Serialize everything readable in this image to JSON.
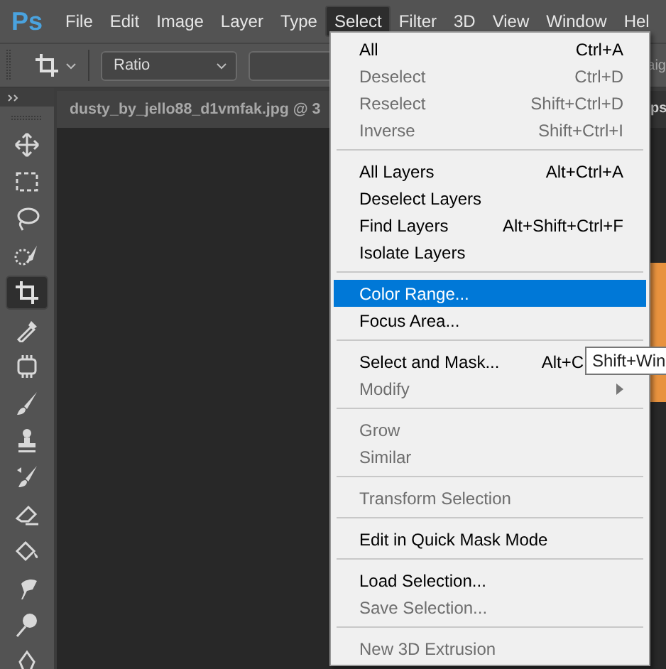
{
  "app_logo": "Ps",
  "menubar": [
    {
      "label": "File",
      "selected": false
    },
    {
      "label": "Edit",
      "selected": false
    },
    {
      "label": "Image",
      "selected": false
    },
    {
      "label": "Layer",
      "selected": false
    },
    {
      "label": "Type",
      "selected": false
    },
    {
      "label": "Select",
      "selected": true
    },
    {
      "label": "Filter",
      "selected": false
    },
    {
      "label": "3D",
      "selected": false
    },
    {
      "label": "View",
      "selected": false
    },
    {
      "label": "Window",
      "selected": false
    },
    {
      "label": "Hel",
      "selected": false
    }
  ],
  "options_bar": {
    "ratio_dropdown": "Ratio",
    "text_right": "aig"
  },
  "tools": [
    {
      "kind": "move",
      "selected": false
    },
    {
      "kind": "marquee",
      "selected": false
    },
    {
      "kind": "lasso",
      "selected": false
    },
    {
      "kind": "quick-select",
      "selected": false
    },
    {
      "kind": "crop",
      "selected": true
    },
    {
      "kind": "eyedropper",
      "selected": false
    },
    {
      "kind": "frame",
      "selected": false
    },
    {
      "kind": "brush",
      "selected": false
    },
    {
      "kind": "stamp",
      "selected": false
    },
    {
      "kind": "history-brush",
      "selected": false
    },
    {
      "kind": "eraser",
      "selected": false
    },
    {
      "kind": "bucket",
      "selected": false
    },
    {
      "kind": "smudge",
      "selected": false
    },
    {
      "kind": "dodge",
      "selected": false
    },
    {
      "kind": "pen",
      "selected": false
    }
  ],
  "document_tabs": [
    {
      "title": "dusty_by_jello88_d1vmfak.jpg @ 3"
    },
    {
      "title": "ps"
    }
  ],
  "menu": {
    "items": [
      {
        "kind": "item",
        "label": "All",
        "shortcut": "Ctrl+A",
        "disabled": false,
        "selected": false
      },
      {
        "kind": "item",
        "label": "Deselect",
        "shortcut": "Ctrl+D",
        "disabled": true,
        "selected": false
      },
      {
        "kind": "item",
        "label": "Reselect",
        "shortcut": "Shift+Ctrl+D",
        "disabled": true,
        "selected": false
      },
      {
        "kind": "item",
        "label": "Inverse",
        "shortcut": "Shift+Ctrl+I",
        "disabled": true,
        "selected": false
      },
      {
        "kind": "separator"
      },
      {
        "kind": "item",
        "label": "All Layers",
        "shortcut": "Alt+Ctrl+A",
        "disabled": false,
        "selected": false
      },
      {
        "kind": "item",
        "label": "Deselect Layers",
        "disabled": false,
        "selected": false
      },
      {
        "kind": "item",
        "label": "Find Layers",
        "shortcut": "Alt+Shift+Ctrl+F",
        "disabled": false,
        "selected": false
      },
      {
        "kind": "item",
        "label": "Isolate Layers",
        "disabled": false,
        "selected": false
      },
      {
        "kind": "separator"
      },
      {
        "kind": "item",
        "label": "Color Range...",
        "disabled": false,
        "selected": true
      },
      {
        "kind": "item",
        "label": "Focus Area...",
        "disabled": false,
        "selected": false
      },
      {
        "kind": "separator"
      },
      {
        "kind": "item",
        "label": "Select and Mask...",
        "shortcut": "Alt+C",
        "shortcut_covered": true,
        "disabled": false,
        "selected": false
      },
      {
        "kind": "item",
        "label": "Modify",
        "disabled": true,
        "selected": false,
        "submenu": true
      },
      {
        "kind": "separator"
      },
      {
        "kind": "item",
        "label": "Grow",
        "disabled": true,
        "selected": false
      },
      {
        "kind": "item",
        "label": "Similar",
        "disabled": true,
        "selected": false
      },
      {
        "kind": "separator"
      },
      {
        "kind": "item",
        "label": "Transform Selection",
        "disabled": true,
        "selected": false
      },
      {
        "kind": "separator"
      },
      {
        "kind": "item",
        "label": "Edit in Quick Mask Mode",
        "disabled": false,
        "selected": false
      },
      {
        "kind": "separator"
      },
      {
        "kind": "item",
        "label": "Load Selection...",
        "disabled": false,
        "selected": false
      },
      {
        "kind": "item",
        "label": "Save Selection...",
        "disabled": true,
        "selected": false
      },
      {
        "kind": "separator"
      },
      {
        "kind": "item",
        "label": "New 3D Extrusion",
        "disabled": true,
        "selected": false
      }
    ]
  },
  "tooltip": "Shift+Win"
}
